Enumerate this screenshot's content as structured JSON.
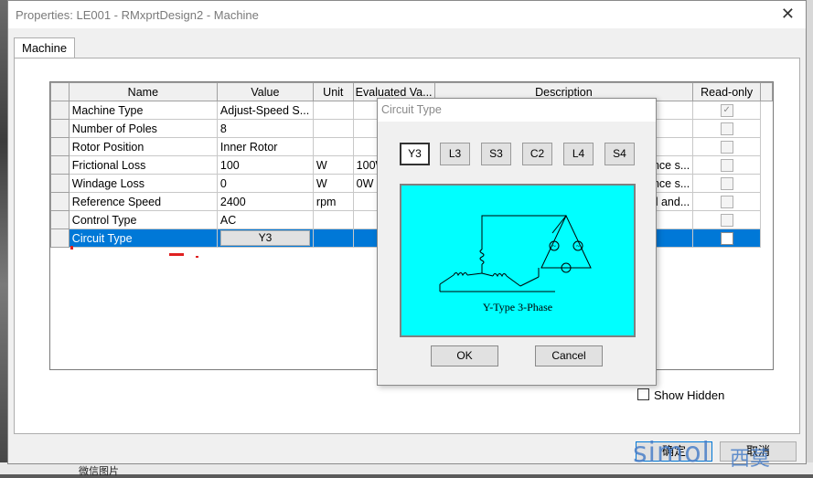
{
  "window": {
    "title": "Properties: LE001 - RMxprtDesign2 - Machine",
    "close_glyph": "✕",
    "tab": "Machine"
  },
  "grid": {
    "columns": [
      "Name",
      "Value",
      "Unit",
      "Evaluated Va...",
      "Description",
      "Read-only"
    ],
    "rows": [
      {
        "name": "Machine Type",
        "value": "Adjust-Speed S...",
        "unit": "",
        "evaluated": "",
        "description": "",
        "readonly": "checked"
      },
      {
        "name": "Number of Poles",
        "value": "8",
        "unit": "",
        "evaluated": "",
        "description": "",
        "readonly": "unchecked"
      },
      {
        "name": "Rotor Position",
        "value": "Inner Rotor",
        "unit": "",
        "evaluated": "",
        "description": "",
        "readonly": "unchecked"
      },
      {
        "name": "Frictional Loss",
        "value": "100",
        "unit": "W",
        "evaluated": "100W",
        "description": "nce s...",
        "readonly": "unchecked"
      },
      {
        "name": "Windage Loss",
        "value": "0",
        "unit": "W",
        "evaluated": "0W",
        "description": "nce s...",
        "readonly": "unchecked"
      },
      {
        "name": "Reference Speed",
        "value": "2400",
        "unit": "rpm",
        "evaluated": "",
        "description": "al and...",
        "readonly": "unchecked"
      },
      {
        "name": "Control Type",
        "value": "AC",
        "unit": "",
        "evaluated": "",
        "description": "",
        "readonly": "unchecked"
      },
      {
        "name": "Circuit Type",
        "value": "Y3",
        "unit": "",
        "evaluated": "",
        "description": "",
        "readonly": "unchecked"
      }
    ]
  },
  "show_hidden_label": "Show Hidden",
  "bottom_buttons": {
    "ok": "确定",
    "cancel": "取消"
  },
  "watermark": {
    "text": "simol",
    "cn": "西莫"
  },
  "taskbar_caption": "微信图片",
  "circuit_dialog": {
    "title": "Circuit Type",
    "types": [
      "Y3",
      "L3",
      "S3",
      "C2",
      "L4",
      "S4"
    ],
    "selected": "Y3",
    "preview_caption": "Y-Type 3-Phase",
    "preview_bg": "#00ffff",
    "ok": "OK",
    "cancel": "Cancel"
  },
  "colors": {
    "selection": "#0078d7",
    "accent_border": "#0078d7"
  }
}
